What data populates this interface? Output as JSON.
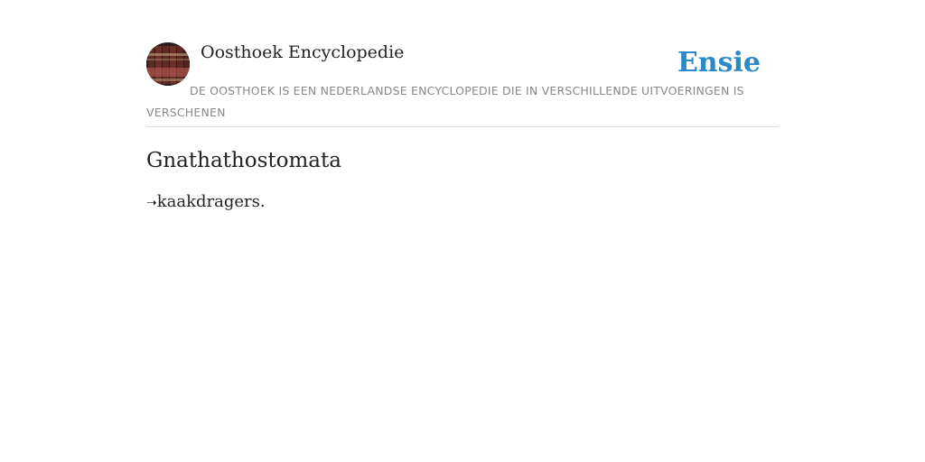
{
  "header": {
    "site_title": "Oosthoek Encyclopedie",
    "brand": "Ensie",
    "tagline": "De Oosthoek is een Nederlandse encyclopedie die in verschillende uitvoeringen is verschenen",
    "avatar_icon": "encyclopedia-books-avatar",
    "brand_color": "#2a8ac8"
  },
  "entry": {
    "title": "Gnathathostomata",
    "arrow": "➝",
    "reference": "kaakdragers."
  }
}
